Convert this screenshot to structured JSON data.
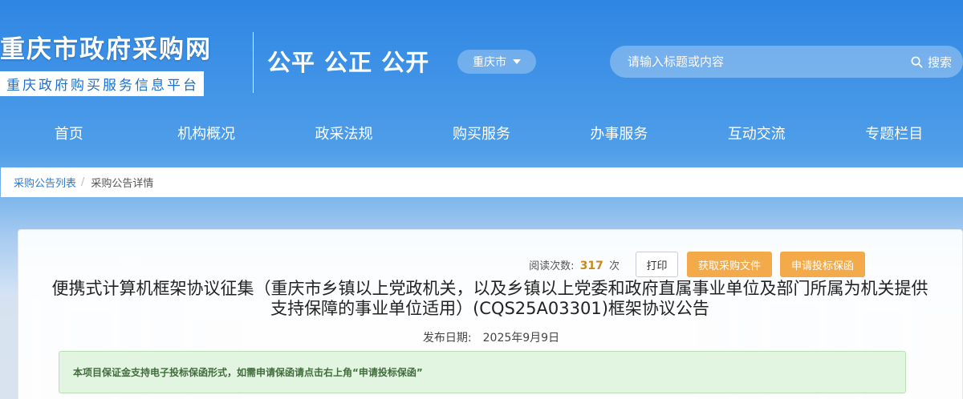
{
  "header": {
    "site_title": "重庆市政府采购网",
    "site_subtitle": "重庆政府购买服务信息平台",
    "slogan": "公平  公正  公开",
    "region_selected": "重庆市"
  },
  "search": {
    "placeholder": "请输入标题或内容",
    "button_label": "搜索"
  },
  "nav": {
    "items": [
      "首页",
      "机构概况",
      "政采法规",
      "购买服务",
      "办事服务",
      "互动交流",
      "专题栏目"
    ]
  },
  "breadcrumb": {
    "parent": "采购公告列表",
    "separator": "/",
    "current": "采购公告详情"
  },
  "article": {
    "read_label": "阅读次数:",
    "read_count": "317",
    "read_unit": "次",
    "print_label": "打印",
    "get_docs_label": "获取采购文件",
    "apply_guarantee_label": "申请投标保函",
    "title": "便携式计算机框架协议征集（重庆市乡镇以上党政机关，以及乡镇以上党委和政府直属事业单位及部门所属为机关提供支持保障的事业单位适用）(CQS25A03301)框架协议公告",
    "publish_label": "发布日期:",
    "publish_date": "2025年9月9日",
    "notice": "本项目保证金支持电子投标保函形式，如需申请保函请点击右上角“申请投标保函”"
  },
  "colors": {
    "brand_blue": "#2f86e3",
    "accent_orange": "#f3aa4a",
    "notice_green": "#e2f5e0",
    "link_blue": "#2c7ad6"
  }
}
